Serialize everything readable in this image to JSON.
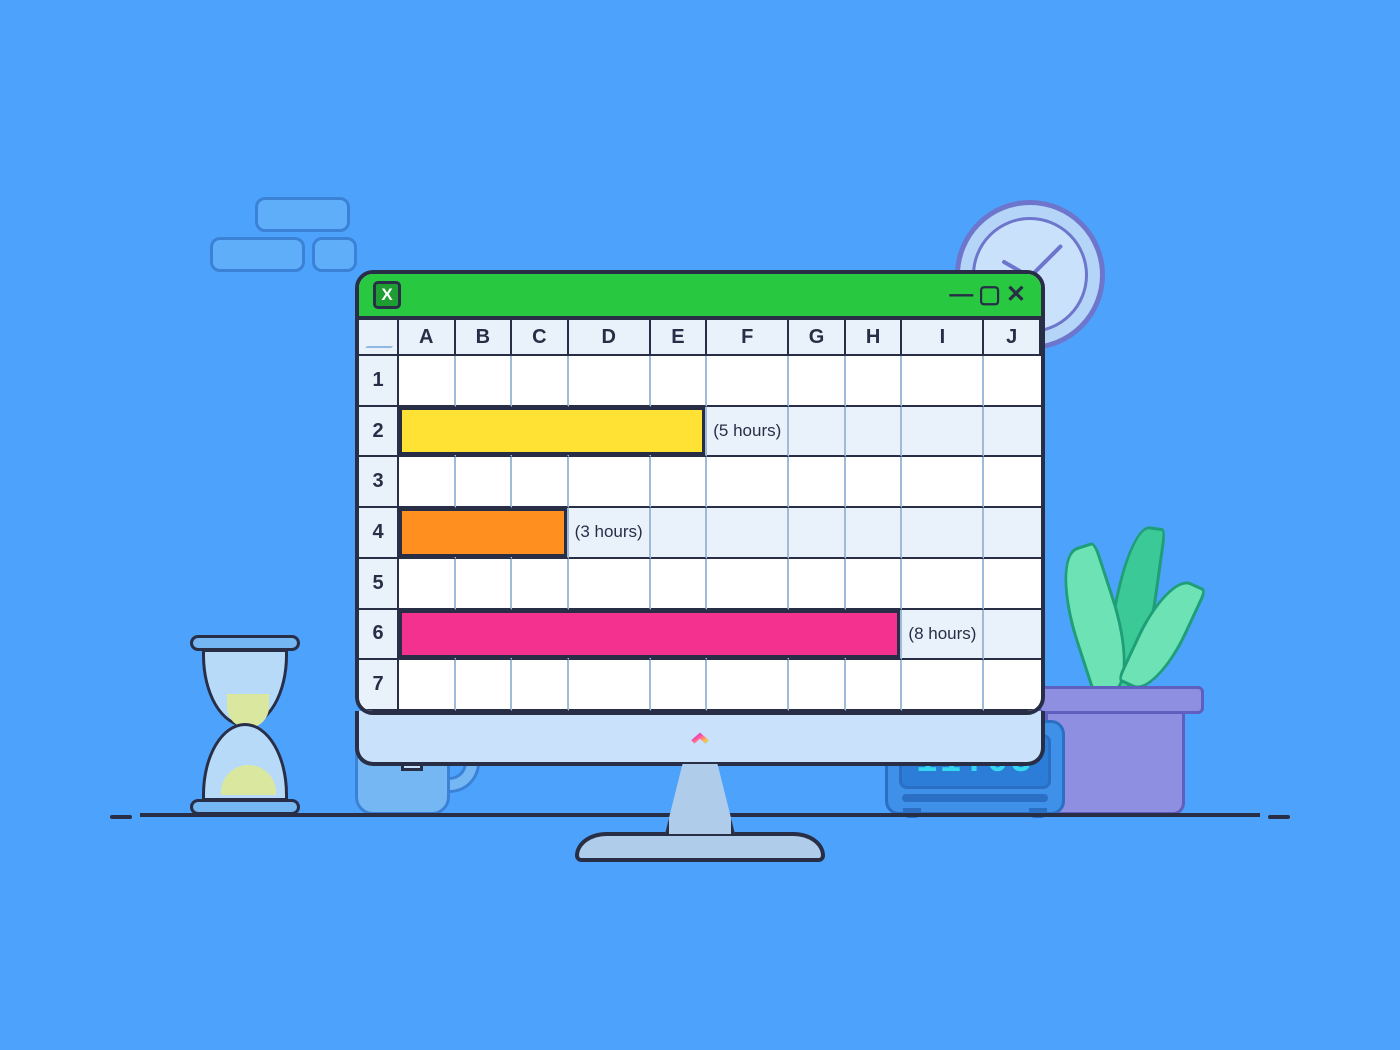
{
  "titlebar": {
    "app_icon_letter": "X",
    "controls": {
      "minimize": "—",
      "maximize": "▢",
      "close": "✕"
    }
  },
  "spreadsheet": {
    "columns": [
      "A",
      "B",
      "C",
      "D",
      "E",
      "F",
      "G",
      "H",
      "I",
      "J"
    ],
    "rows": [
      "1",
      "2",
      "3",
      "4",
      "5",
      "6",
      "7"
    ],
    "entries": [
      {
        "row": 2,
        "bar_start": "A",
        "bar_end": "E",
        "color": "yellow",
        "label_col": "F",
        "label": "(5 hours)"
      },
      {
        "row": 4,
        "bar_start": "A",
        "bar_end": "C",
        "color": "orange",
        "label_col": "D",
        "label": "(3 hours)"
      },
      {
        "row": 6,
        "bar_start": "A",
        "bar_end": "H",
        "color": "pink",
        "label_col": "I",
        "label": "(8 hours)"
      }
    ]
  },
  "digital_clock": {
    "time": "11:05"
  },
  "colors": {
    "background": "#4DA2FB",
    "titlebar_green": "#28C840",
    "bar_yellow": "#FFE234",
    "bar_orange": "#FF9020",
    "bar_pink": "#F5318F"
  }
}
